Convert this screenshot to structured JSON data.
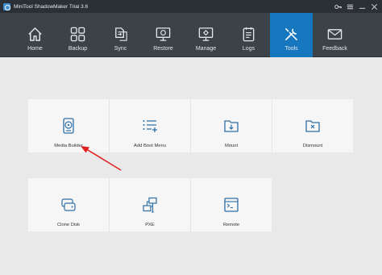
{
  "window": {
    "title": "MiniTool ShadowMaker Trial 3.6"
  },
  "nav": [
    {
      "label": "Home",
      "icon": "home-icon"
    },
    {
      "label": "Backup",
      "icon": "backup-icon"
    },
    {
      "label": "Sync",
      "icon": "sync-icon"
    },
    {
      "label": "Restore",
      "icon": "restore-icon"
    },
    {
      "label": "Manage",
      "icon": "manage-icon"
    },
    {
      "label": "Logs",
      "icon": "logs-icon"
    },
    {
      "label": "Tools",
      "icon": "tools-icon",
      "active": true
    },
    {
      "label": "Feedback",
      "icon": "feedback-icon"
    }
  ],
  "tools": {
    "row1": [
      {
        "label": "Media Builder",
        "icon": "media-builder-icon"
      },
      {
        "label": "Add Boot Menu",
        "icon": "add-boot-menu-icon"
      },
      {
        "label": "Mount",
        "icon": "mount-icon"
      },
      {
        "label": "Dismount",
        "icon": "dismount-icon"
      }
    ],
    "row2": [
      {
        "label": "Clone Disk",
        "icon": "clone-disk-icon"
      },
      {
        "label": "PXE",
        "icon": "pxe-icon"
      },
      {
        "label": "Remote",
        "icon": "remote-icon"
      }
    ]
  },
  "colors": {
    "accent": "#1677bf",
    "toolbar": "#3b4248",
    "titlebar": "#2a3036",
    "arrow": "#e02020",
    "icon": "#2f6fa5"
  }
}
